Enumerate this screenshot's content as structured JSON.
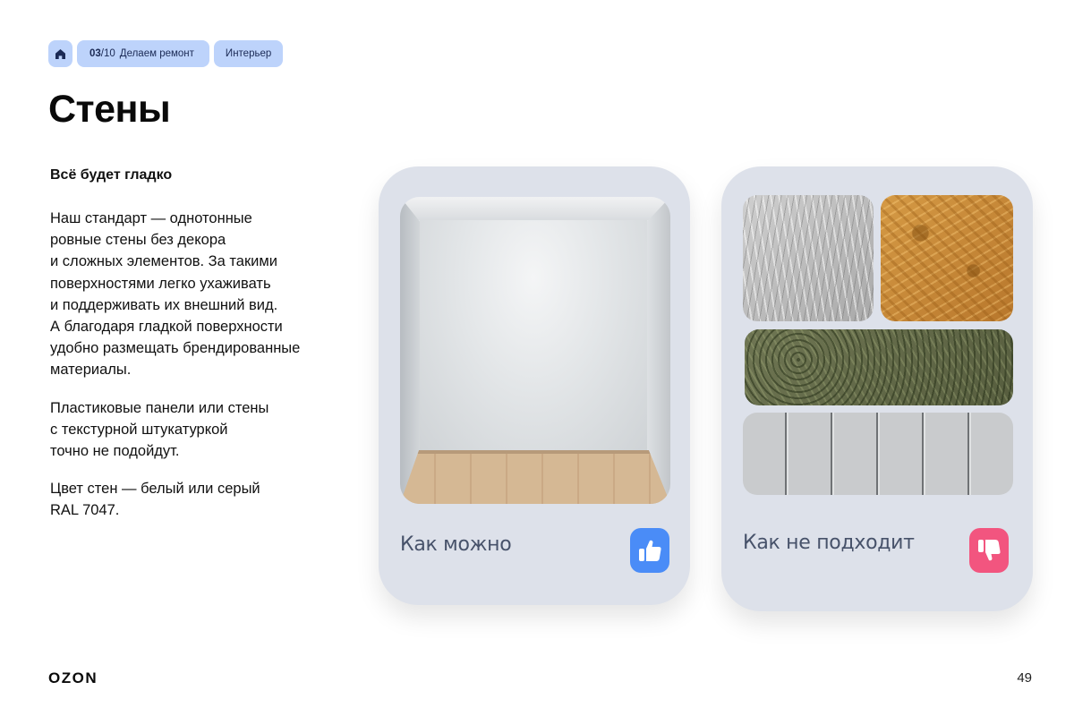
{
  "breadcrumb": {
    "home_icon": "home-icon",
    "section_number": "03",
    "section_total": "/10",
    "section_title": "Делаем ремонт",
    "tag": "Интерьер"
  },
  "page_title": "Стены",
  "subtitle": "Всё будет гладко",
  "paragraphs": [
    "Наш стандарт — однотонные\nровные стены без декора\nи сложных элементов. За такими\nповерхностями легко ухаживать\nи поддерживать их внешний вид.\nА благодаря гладкой поверхности\nудобно размещать брендированные\nматериалы.",
    "Пластиковые панели или стены\nс текстурной штукатуркой\nточно не подойдут.",
    "Цвет стен — белый или серый\nRAL 7047."
  ],
  "cards": {
    "good": {
      "label": "Как можно",
      "icon": "thumbs-up-icon",
      "accent": "#4a8cf7"
    },
    "bad": {
      "label": "Как не подходит",
      "icon": "thumbs-down-icon",
      "accent": "#f2557f"
    }
  },
  "colors": {
    "breadcrumb_bg": "#bdd3fb",
    "card_bg": "#dde1ea"
  },
  "footer": {
    "logo": "OZON",
    "page_number": "49"
  }
}
